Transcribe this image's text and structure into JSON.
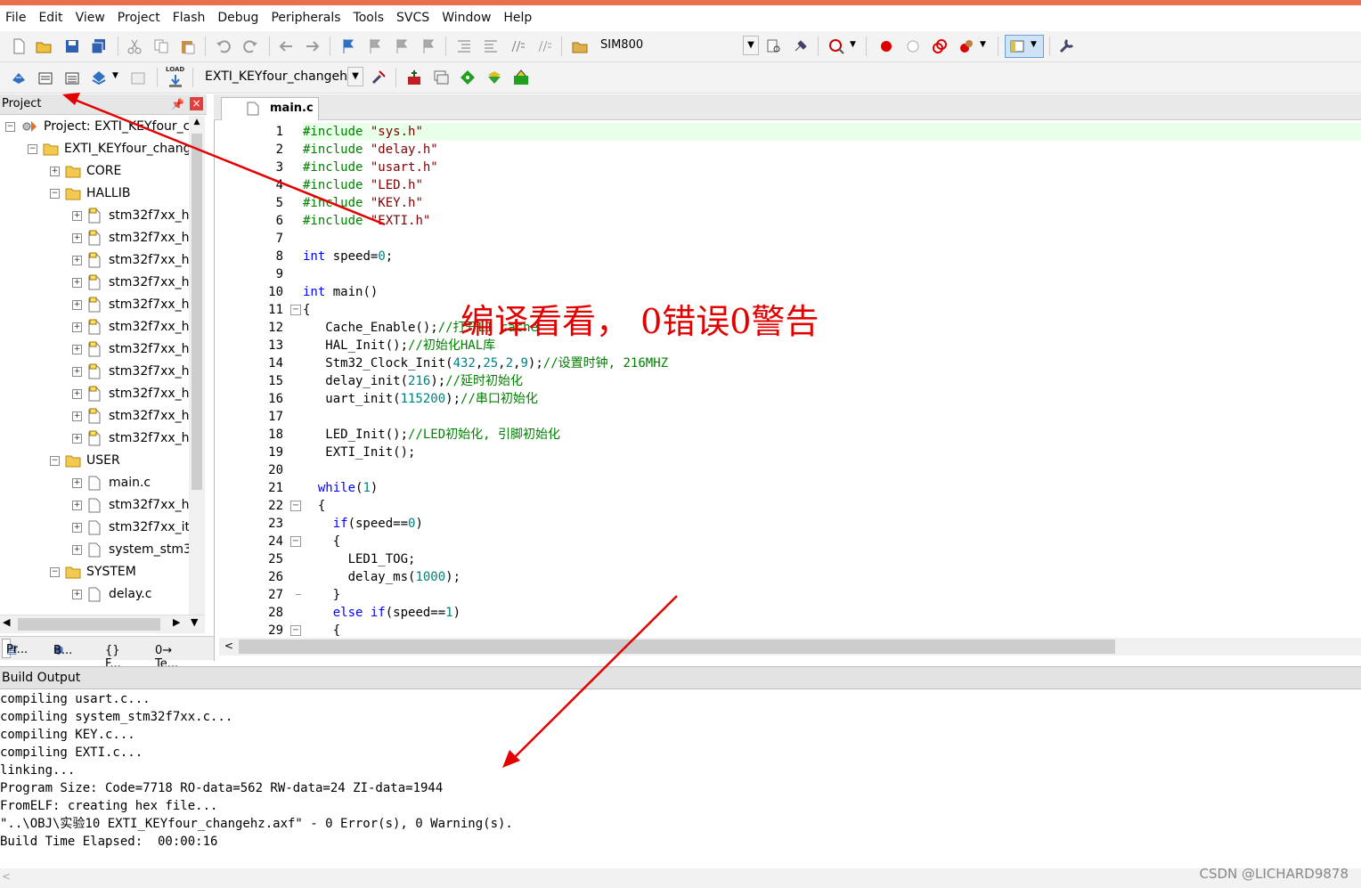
{
  "menu": [
    "File",
    "Edit",
    "View",
    "Project",
    "Flash",
    "Debug",
    "Peripherals",
    "Tools",
    "SVCS",
    "Window",
    "Help"
  ],
  "toolbar1": {
    "target_combo": "SIM800"
  },
  "toolbar2": {
    "project_combo": "EXTI_KEYfour_changehz",
    "load_label": "LOAD"
  },
  "project_panel": {
    "title": "Project",
    "pin_glyph": " ",
    "close_glyph": "×",
    "tree": [
      {
        "label": "Project: EXTI_KEYfour_cl",
        "level": 0,
        "kind": "project"
      },
      {
        "label": "EXTI_KEYfour_chang",
        "level": 1,
        "kind": "target"
      },
      {
        "label": "CORE",
        "level": 2,
        "kind": "folder"
      },
      {
        "label": "HALLIB",
        "level": 2,
        "kind": "folder-open"
      },
      {
        "label": "stm32f7xx_h",
        "level": 3,
        "kind": "file-lib"
      },
      {
        "label": "stm32f7xx_h",
        "level": 3,
        "kind": "file-lib"
      },
      {
        "label": "stm32f7xx_h",
        "level": 3,
        "kind": "file-lib"
      },
      {
        "label": "stm32f7xx_h",
        "level": 3,
        "kind": "file-lib"
      },
      {
        "label": "stm32f7xx_h",
        "level": 3,
        "kind": "file-lib"
      },
      {
        "label": "stm32f7xx_h",
        "level": 3,
        "kind": "file-lib"
      },
      {
        "label": "stm32f7xx_h",
        "level": 3,
        "kind": "file-lib"
      },
      {
        "label": "stm32f7xx_h",
        "level": 3,
        "kind": "file-lib"
      },
      {
        "label": "stm32f7xx_h",
        "level": 3,
        "kind": "file-lib"
      },
      {
        "label": "stm32f7xx_h",
        "level": 3,
        "kind": "file-lib"
      },
      {
        "label": "stm32f7xx_h",
        "level": 3,
        "kind": "file-lib"
      },
      {
        "label": "USER",
        "level": 2,
        "kind": "folder-open"
      },
      {
        "label": "main.c",
        "level": 3,
        "kind": "file"
      },
      {
        "label": "stm32f7xx_h",
        "level": 3,
        "kind": "file"
      },
      {
        "label": "stm32f7xx_it",
        "level": 3,
        "kind": "file"
      },
      {
        "label": "system_stm3",
        "level": 3,
        "kind": "file"
      },
      {
        "label": "SYSTEM",
        "level": 2,
        "kind": "folder-open"
      },
      {
        "label": "delay.c",
        "level": 3,
        "kind": "file"
      }
    ],
    "tabs": [
      "Pr...",
      "B...",
      "{} F...",
      "0→ Te..."
    ]
  },
  "editor": {
    "tab": "main.c",
    "lines": [
      {
        "n": "1",
        "html": "<span class='pp'>#include</span> <span class='str'>\"sys.h\"</span>"
      },
      {
        "n": "2",
        "html": "<span class='pp'>#include</span> <span class='str'>\"delay.h\"</span>"
      },
      {
        "n": "3",
        "html": "<span class='pp'>#include</span> <span class='str'>\"usart.h\"</span>"
      },
      {
        "n": "4",
        "html": "<span class='pp'>#include</span> <span class='str'>\"LED.h\"</span>"
      },
      {
        "n": "5",
        "html": "<span class='pp'>#include</span> <span class='str'>\"KEY.h\"</span>"
      },
      {
        "n": "6",
        "html": "<span class='pp'>#include</span> <span class='str'>\"EXTI.h\"</span>"
      },
      {
        "n": "7",
        "html": ""
      },
      {
        "n": "8",
        "html": "<span class='kw'>int</span> speed=<span class='num'>0</span>;"
      },
      {
        "n": "9",
        "html": ""
      },
      {
        "n": "10",
        "html": "<span class='kw'>int</span> main()"
      },
      {
        "n": "11",
        "html": "{"
      },
      {
        "n": "12",
        "html": "   Cache_Enable();<span class='cm'>//打开L1 cache</span>"
      },
      {
        "n": "13",
        "html": "   HAL_Init();<span class='cm'>//初始化HAL库</span>"
      },
      {
        "n": "14",
        "html": "   Stm32_Clock_Init(<span class='num'>432</span>,<span class='num'>25</span>,<span class='num'>2</span>,<span class='num'>9</span>);<span class='cm'>//设置时钟, 216MHZ</span>"
      },
      {
        "n": "15",
        "html": "   delay_init(<span class='num'>216</span>);<span class='cm'>//延时初始化</span>"
      },
      {
        "n": "16",
        "html": "   uart_init(<span class='num'>115200</span>);<span class='cm'>//串口初始化</span>"
      },
      {
        "n": "17",
        "html": ""
      },
      {
        "n": "18",
        "html": "   LED_Init();<span class='cm'>//LED初始化, 引脚初始化</span>"
      },
      {
        "n": "19",
        "html": "   EXTI_Init();"
      },
      {
        "n": "20",
        "html": ""
      },
      {
        "n": "21",
        "html": "  <span class='kw'>while</span>(<span class='num'>1</span>)"
      },
      {
        "n": "22",
        "html": "  {"
      },
      {
        "n": "23",
        "html": "    <span class='kw'>if</span>(speed==<span class='num'>0</span>)"
      },
      {
        "n": "24",
        "html": "    {"
      },
      {
        "n": "25",
        "html": "      LED1_TOG;"
      },
      {
        "n": "26",
        "html": "      delay_ms(<span class='num'>1000</span>);"
      },
      {
        "n": "27",
        "html": "    }"
      },
      {
        "n": "28",
        "html": "    <span class='kw'>else</span> <span class='kw'>if</span>(speed==<span class='num'>1</span>)"
      },
      {
        "n": "29",
        "html": "    {"
      }
    ]
  },
  "annotation": "编译看看，  0错误0警告",
  "build_output": {
    "title": "Build Output",
    "lines": [
      "compiling usart.c...",
      "compiling system_stm32f7xx.c...",
      "compiling KEY.c...",
      "compiling EXTI.c...",
      "linking...",
      "Program Size: Code=7718 RO-data=562 RW-data=24 ZI-data=1944",
      "FromELF: creating hex file...",
      "\"..\\OBJ\\实验10 EXTI_KEYfour_changehz.axf\" - 0 Error(s), 0 Warning(s).",
      "Build Time Elapsed:  00:00:16"
    ]
  },
  "watermark": "CSDN @LICHARD9878",
  "colors": {
    "accent": "#e8704a",
    "arrow": "#e30000",
    "keyword": "#0000ff",
    "comment": "#008000",
    "string": "#800000",
    "number": "#008080",
    "current_line": "#e8ffe8"
  }
}
